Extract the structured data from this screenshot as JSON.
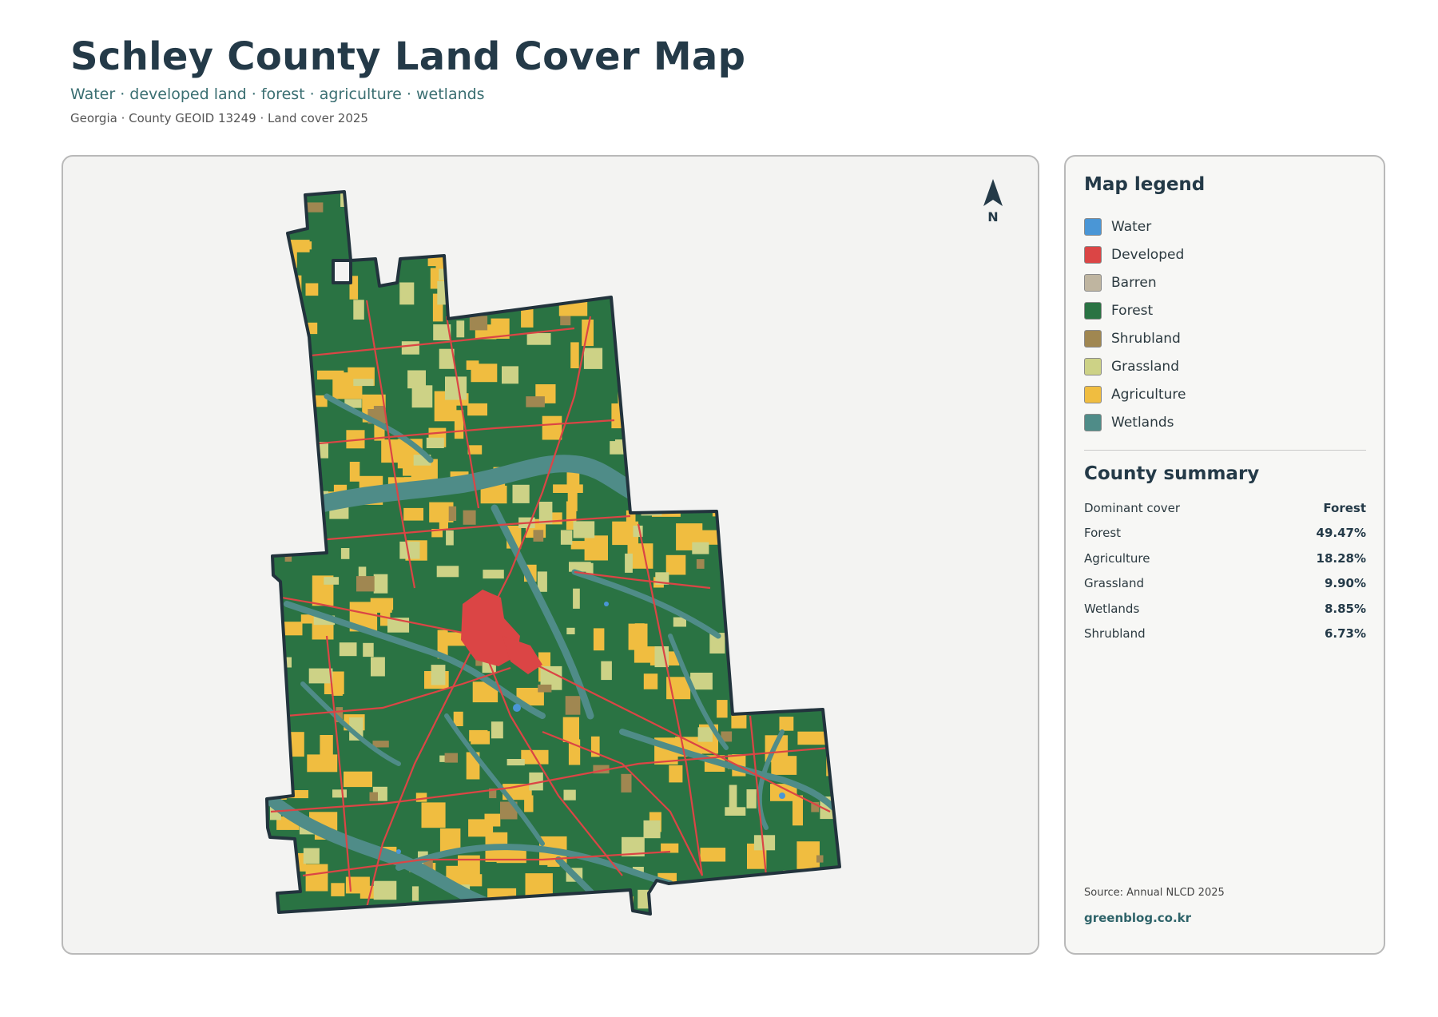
{
  "header": {
    "title": "Schley County Land Cover Map",
    "subtitle": "Water · developed land · forest · agriculture · wetlands",
    "meta": "Georgia · County GEOID 13249 · Land cover 2025"
  },
  "map": {
    "north_label": "N",
    "colors": {
      "water": "#4a96d6",
      "developed": "#db4545",
      "barren": "#bfb5a0",
      "forest": "#2a7343",
      "shrubland": "#a08751",
      "grassland": "#cdd286",
      "agriculture": "#f0bd40",
      "wetlands": "#4f8c88",
      "boundary": "#22333d"
    }
  },
  "legend": {
    "heading": "Map legend",
    "items": [
      {
        "label": "Water",
        "color": "#4a96d6"
      },
      {
        "label": "Developed",
        "color": "#db4545"
      },
      {
        "label": "Barren",
        "color": "#bfb5a0"
      },
      {
        "label": "Forest",
        "color": "#2a7343"
      },
      {
        "label": "Shrubland",
        "color": "#a08751"
      },
      {
        "label": "Grassland",
        "color": "#cdd286"
      },
      {
        "label": "Agriculture",
        "color": "#f0bd40"
      },
      {
        "label": "Wetlands",
        "color": "#4f8c88"
      }
    ]
  },
  "summary": {
    "heading": "County summary",
    "rows": [
      {
        "label": "Dominant cover",
        "value": "Forest"
      },
      {
        "label": "Forest",
        "value": "49.47%"
      },
      {
        "label": "Agriculture",
        "value": "18.28%"
      },
      {
        "label": "Grassland",
        "value": "9.90%"
      },
      {
        "label": "Wetlands",
        "value": "8.85%"
      },
      {
        "label": "Shrubland",
        "value": "6.73%"
      }
    ]
  },
  "footer": {
    "source": "Source: Annual NLCD 2025",
    "site": "greenblog.co.kr"
  }
}
